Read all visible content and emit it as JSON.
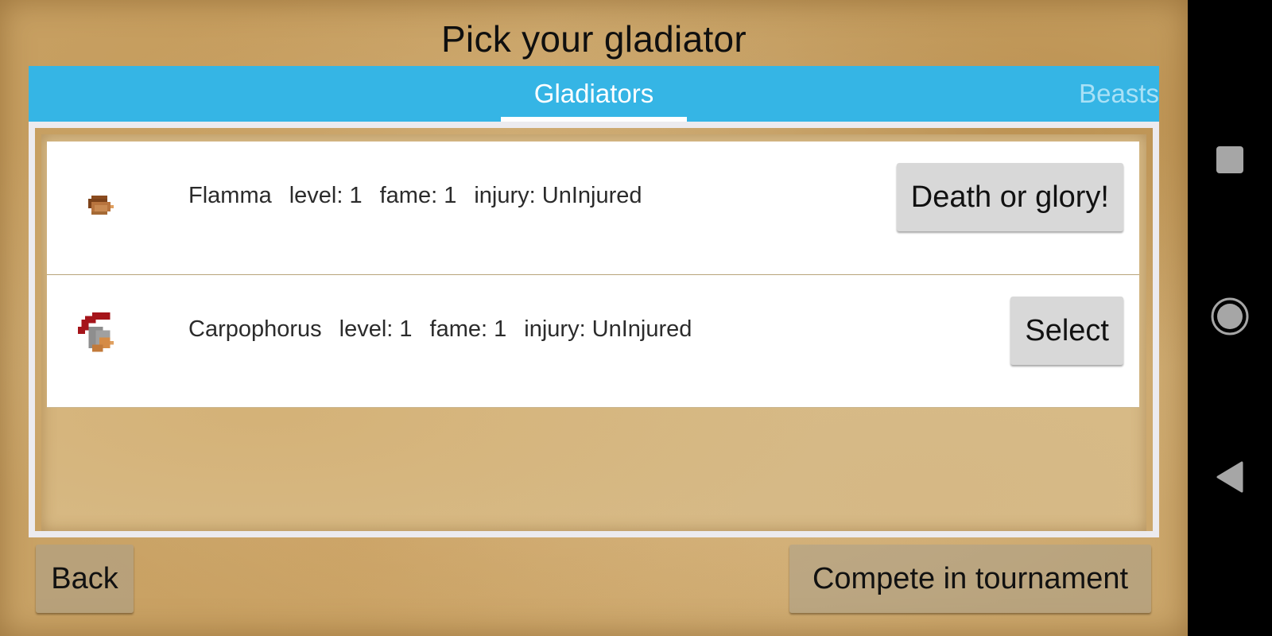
{
  "screen": {
    "title": "Pick your gladiator"
  },
  "tabs": [
    {
      "label": "Gladiators",
      "selected": true
    },
    {
      "label": "Beasts",
      "selected": false
    }
  ],
  "gladiators": [
    {
      "name": "Flamma",
      "level": "level: 1",
      "fame": "fame: 1",
      "injury": "injury: UnInjured",
      "sprite": "bare-head-gladiator-icon",
      "action_label": "Death or glory!"
    },
    {
      "name": "Carpophorus",
      "level": "level: 1",
      "fame": "fame: 1",
      "injury": "injury: UnInjured",
      "sprite": "crested-helmet-gladiator-icon",
      "action_label": "Select"
    }
  ],
  "footer": {
    "back_label": "Back",
    "compete_label": "Compete in tournament"
  },
  "system_nav": {
    "recents": "square-icon",
    "home": "circle-icon",
    "back": "triangle-back-icon"
  },
  "colors": {
    "tab_bar": "#35b5e5",
    "tab_active_text": "#ffffff",
    "tab_inactive_text": "#a9e1f6",
    "button_bg": "#d8d8d8",
    "helmet_crest": "#a5141a"
  }
}
